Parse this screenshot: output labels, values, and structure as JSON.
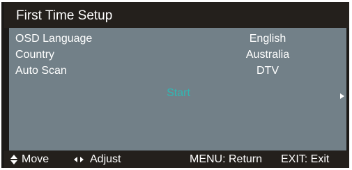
{
  "title": "First Time Setup",
  "settings": [
    {
      "label": "OSD Language",
      "value": "English"
    },
    {
      "label": "Country",
      "value": "Australia"
    },
    {
      "label": "Auto Scan",
      "value": "DTV"
    }
  ],
  "start_label": "Start",
  "hints": {
    "move": "Move",
    "adjust": "Adjust",
    "menu": "MENU: Return",
    "exit": "EXIT: Exit"
  },
  "colors": {
    "panel": "#728088",
    "bars": "#24201c",
    "highlight": "#2fb8b4",
    "text": "#ffffff"
  },
  "icons": {
    "move": "up-down-arrows-icon",
    "adjust": "left-right-arrows-icon",
    "next": "right-arrow-icon"
  }
}
